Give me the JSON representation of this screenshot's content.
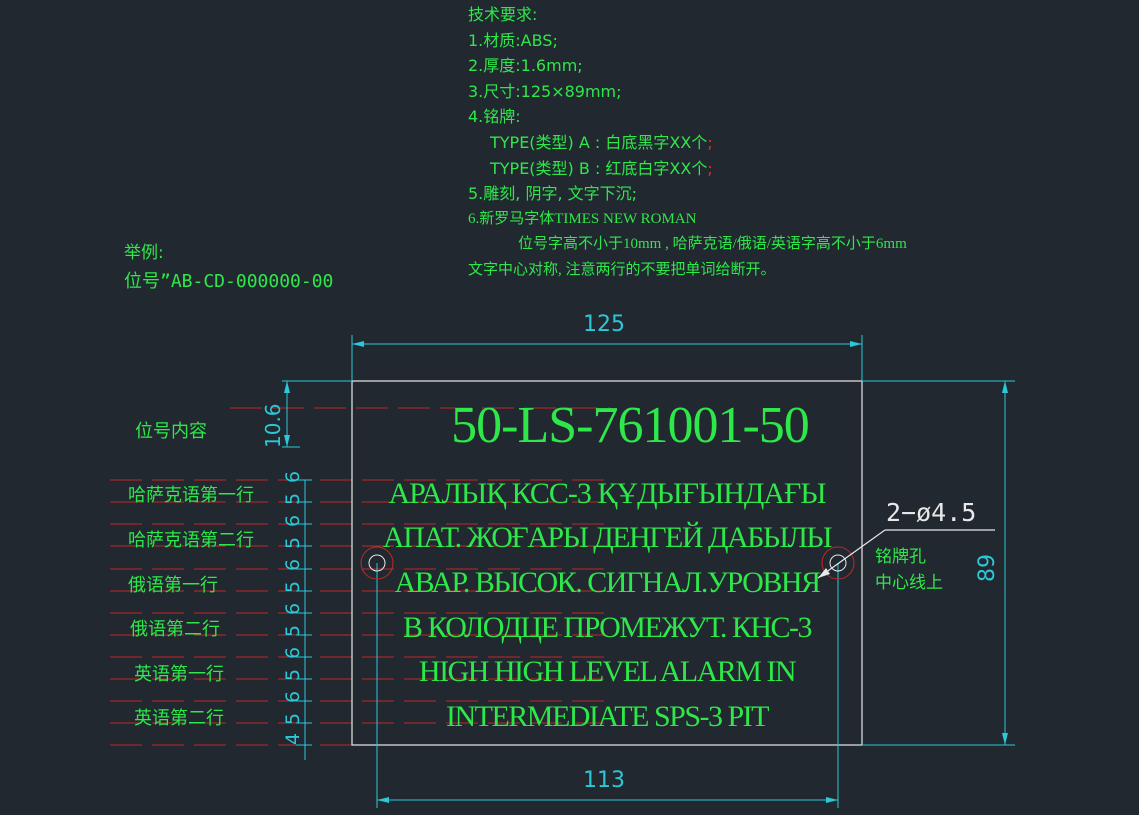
{
  "requirements": {
    "heading": "技术要求:",
    "items": [
      "1.材质:ABS;",
      "2.厚度:1.6mm;",
      "3.尺寸:125×89mm;",
      "4.铭牌:",
      "TYPE(类型) A : 白底黑字XX个",
      "TYPE(类型) B : 红底白字XX个",
      "5.雕刻, 阴字, 文字下沉;",
      "6.新罗马字体TIMES NEW ROMAN",
      "位号字高不小于10mm , 哈萨克语/俄语/英语字高不小于6mm",
      "文字中心对称, 注意两行的不要把单词给断开。"
    ],
    "red_semicolon": ";"
  },
  "example": {
    "label": "举例:",
    "value": "位号”AB-CD-000000-00"
  },
  "dimensions": {
    "width": "125",
    "height": "89",
    "hole_spacing": "113",
    "top_margin": "10.6",
    "line_spacings": [
      "6",
      "5",
      "6",
      "5",
      "6",
      "5",
      "6",
      "5",
      "6",
      "5",
      "6",
      "5",
      "4"
    ],
    "hole_callout": "2−ø4.5",
    "hole_note_line1": "铭牌孔",
    "hole_note_line2": "中心线上"
  },
  "row_labels": [
    "位号内容",
    "哈萨克语第一行",
    "哈萨克语第二行",
    "俄语第一行",
    "俄语第二行",
    "英语第一行",
    "英语第二行"
  ],
  "plate": {
    "tag": "50-LS-761001-50",
    "lines": [
      "АРАЛЫҚ КСС-3 ҚҰДЫҒЫНДАҒЫ",
      "АПАТ. ЖОҒАРЫ ДЕҢГЕЙ ДАБЫЛЫ",
      "АВАР. ВЫСОК. СИГНАЛ.УРОВНЯ",
      "В КОЛОДЦЕ ПРОМЕЖУТ. КНС-3",
      "HIGH HIGH LEVEL ALARM IN",
      "INTERMEDIATE SPS-3 PIT"
    ]
  },
  "colors": {
    "background": "#212830",
    "text_green": "#2ee84a",
    "dimension_cyan": "#2cc8d8",
    "guide_red": "#c02828",
    "outline_white": "#e8e8e8"
  }
}
